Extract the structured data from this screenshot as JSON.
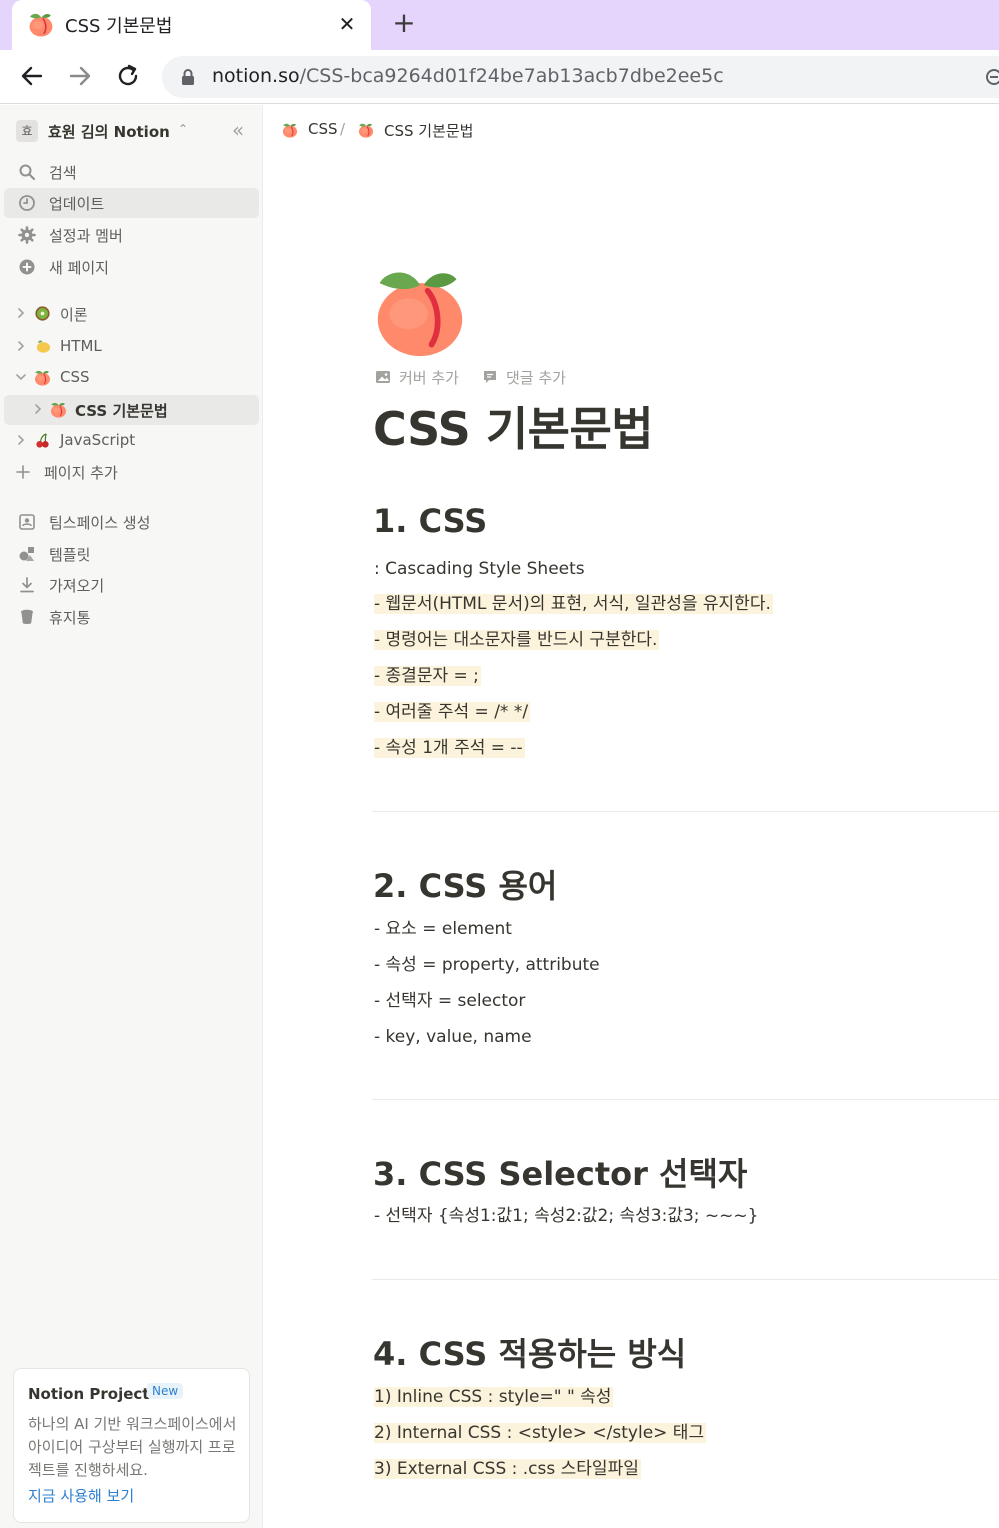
{
  "browser": {
    "tab_title": "CSS 기본문법",
    "close_symbol": "✕",
    "new_tab_symbol": "+",
    "url_host": "notion.so",
    "url_path": "/CSS-bca9264d01f24be7ab13acb7dbe2ee5c"
  },
  "sidebar": {
    "workspace_badge": "효",
    "workspace_name": "효원 김의 Notion",
    "workspace_caret": "⌃",
    "collapse_symbol": "«",
    "menu": [
      {
        "label": "검색",
        "icon": "search-icon"
      },
      {
        "label": "업데이트",
        "icon": "clock-icon"
      },
      {
        "label": "설정과 멤버",
        "icon": "gear-icon"
      },
      {
        "label": "새 페이지",
        "icon": "plus-circle-icon"
      }
    ],
    "tree": [
      {
        "label": "이론",
        "icon": "kiwi-icon"
      },
      {
        "label": "HTML",
        "icon": "lemon-icon"
      },
      {
        "label": "CSS",
        "icon": "peach-icon"
      },
      {
        "label": "CSS 기본문법",
        "icon": "peach-icon"
      },
      {
        "label": "JavaScript",
        "icon": "cherries-icon"
      }
    ],
    "add_page": "페이지 추가",
    "bottom": [
      {
        "label": "팀스페이스 생성",
        "icon": "teamspace-icon"
      },
      {
        "label": "템플릿",
        "icon": "shapes-icon"
      },
      {
        "label": "가져오기",
        "icon": "download-icon"
      },
      {
        "label": "휴지통",
        "icon": "trash-icon"
      }
    ],
    "promo": {
      "title": "Notion Projects",
      "badge": "New",
      "body": "하나의 AI 기반 워크스페이스에서 아이디어 구상부터 실행까지 프로젝트를 진행하세요.",
      "link": "지금 사용해 보기"
    }
  },
  "breadcrumb": {
    "parent": "CSS",
    "separator": "/",
    "current": "CSS 기본문법"
  },
  "page": {
    "add_cover": "커버 추가",
    "add_comment": "댓글 추가",
    "title": "CSS 기본문법",
    "sections": [
      {
        "heading": "1. CSS",
        "lines": [
          ": Cascading Style Sheets",
          "- 웹문서(HTML 문서)의 표현, 서식, 일관성을 유지한다.",
          "- 명령어는 대소문자를 반드시 구분한다.",
          "- 종결문자 = ;",
          "- 여러줄 주석 = /* */",
          "- 속성 1개 주석 = --"
        ]
      },
      {
        "heading": "2. CSS 용어",
        "lines": [
          "- 요소 = element",
          "- 속성 = property, attribute",
          "- 선택자 = selector",
          "- key, value, name"
        ]
      },
      {
        "heading": "3. CSS Selector 선택자",
        "lines": [
          "- 선택자 {속성1:값1; 속성2:값2; 속성3:값3; ~~~}"
        ]
      },
      {
        "heading": "4. CSS 적용하는 방식",
        "lines": [
          "1) Inline CSS : style=\" \" 속성",
          "2) Internal CSS : <style> </style> 태그",
          "3) External CSS : .css 스타일파일"
        ]
      }
    ]
  },
  "colors": {
    "highlight": "#fbf3db",
    "tab_strip": "#e5d4fb",
    "sidebar_bg": "#f7f7f5",
    "link": "#2f80d1"
  }
}
